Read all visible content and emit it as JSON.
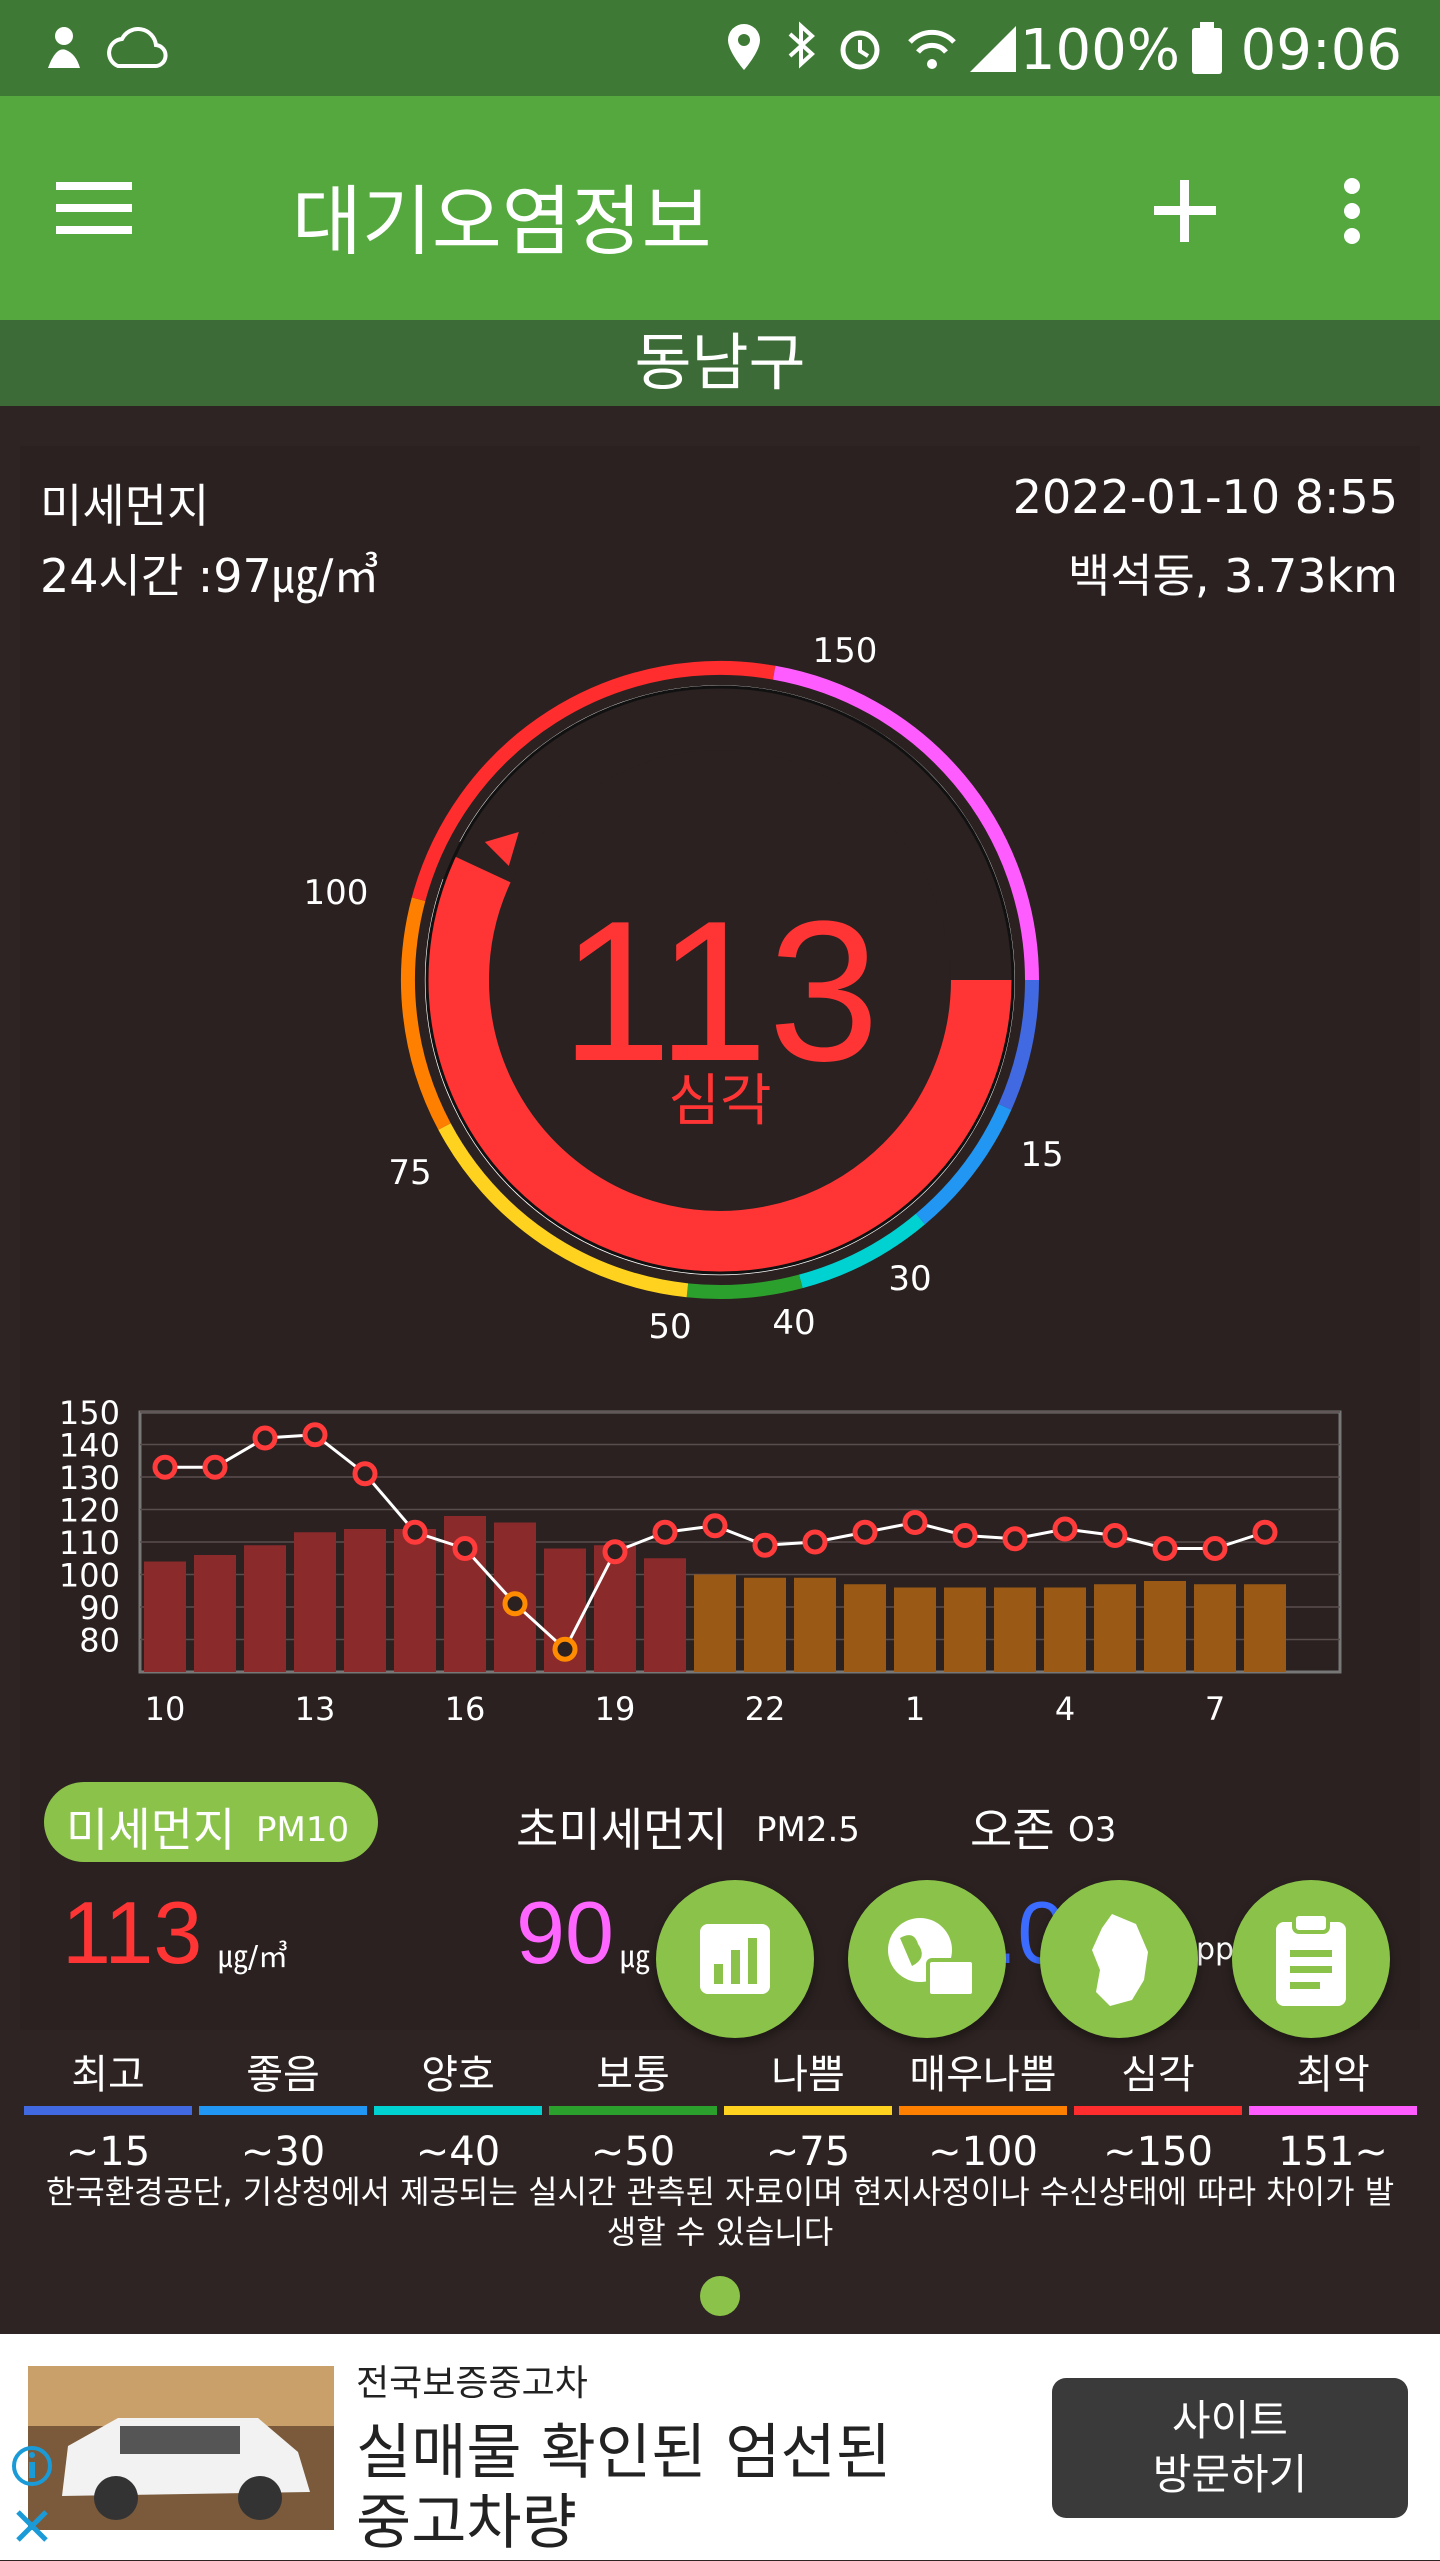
{
  "status_bar": {
    "battery": "100%",
    "time": "09:06"
  },
  "app_bar": {
    "title": "대기오염정보"
  },
  "region": "동남구",
  "card": {
    "pollutant": "미세먼지",
    "avg24": "24시간 :97㎍/㎥",
    "datetime": "2022-01-10 8:55",
    "station": "백석동, 3.73km"
  },
  "gauge": {
    "value": "113",
    "status": "심각",
    "value_num": 113,
    "max": 150,
    "tick_labels": [
      "150",
      "100",
      "75",
      "50",
      "40",
      "30",
      "15"
    ],
    "colors": {
      "value": "#ff3535",
      "track": "#7d7474"
    }
  },
  "chart_data": {
    "type": "bar",
    "x_tick_labels": [
      "10",
      "13",
      "16",
      "19",
      "22",
      "1",
      "4",
      "7"
    ],
    "y_tick_labels": [
      "150",
      "140",
      "130",
      "120",
      "110",
      "100",
      "90",
      "80"
    ],
    "ylim": [
      70,
      150
    ],
    "series": [
      {
        "values": [
          104,
          106,
          109,
          113,
          114,
          114,
          118,
          116,
          108,
          109,
          105,
          100,
          99,
          99,
          97,
          96,
          96,
          96,
          96,
          97,
          98,
          97,
          97
        ]
      },
      {
        "values": [
          133,
          133,
          142,
          143,
          131,
          113,
          108,
          91,
          77,
          107,
          113,
          115,
          109,
          110,
          113,
          116,
          112,
          111,
          114,
          112,
          108,
          108,
          113
        ]
      }
    ],
    "colors": {
      "bar_recent": "#8a2a2a",
      "bar_older": "#9a5a16",
      "line": "#ffffff",
      "marker": "#ff3b3b",
      "marker_low": "#ff8c00"
    }
  },
  "pollutants": {
    "pm10": {
      "name": "미세먼지",
      "code": "PM10",
      "value": "113",
      "unit": "㎍/㎥",
      "color": "#ff3535"
    },
    "pm25": {
      "name": "초미세먼지",
      "code": "PM2.5",
      "value": "90",
      "unit": "㎍",
      "color": "#ff66ff"
    },
    "o3": {
      "name": "오존",
      "code": "O3",
      "value": "0.0",
      "unit": "pp"
    }
  },
  "legend": [
    {
      "label": "최고",
      "range": "~15",
      "color": "#4169e1"
    },
    {
      "label": "좋음",
      "range": "~30",
      "color": "#2196f3"
    },
    {
      "label": "양호",
      "range": "~40",
      "color": "#00d1d1"
    },
    {
      "label": "보통",
      "range": "~50",
      "color": "#2ca02c"
    },
    {
      "label": "나쁨",
      "range": "~75",
      "color": "#ffd21f"
    },
    {
      "label": "매우나쁨",
      "range": "~100",
      "color": "#ff8000"
    },
    {
      "label": "심각",
      "range": "~150",
      "color": "#ff2d2d"
    },
    {
      "label": "최악",
      "range": "151~",
      "color": "#ff5cff"
    }
  ],
  "notice": "한국환경공단, 기상청에서 제공되는 실시간 관측된 자료이며 현지사정이나 수신상태에 따라 차이가 발생할 수 있습니다",
  "ad": {
    "advertiser": "전국보증중고차",
    "headline_1": "실매물 확인된 엄선된",
    "headline_2": "중고차량",
    "button_1": "사이트",
    "button_2": "방문하기"
  }
}
